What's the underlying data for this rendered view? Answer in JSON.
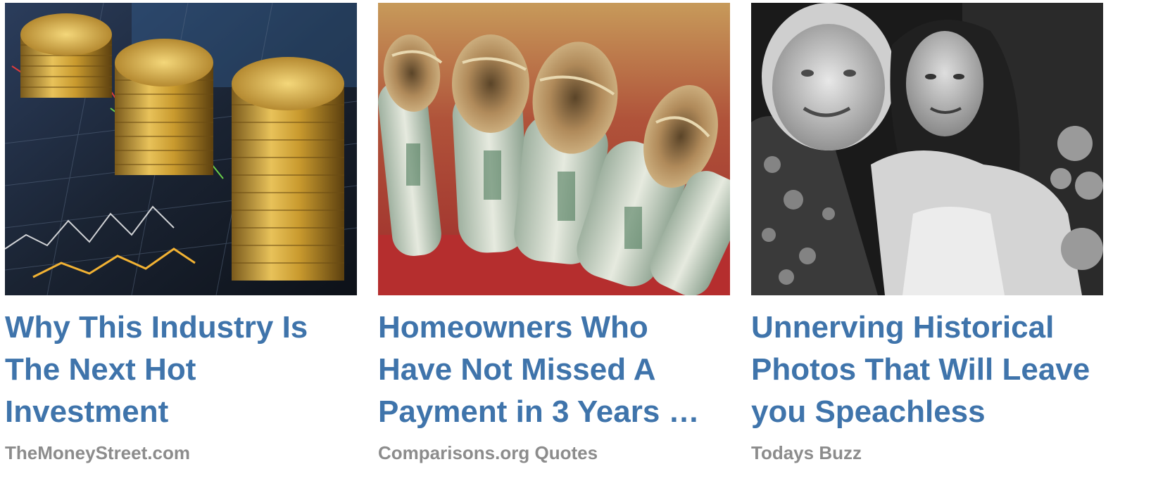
{
  "cards": [
    {
      "headline_lines": [
        "Why This Industry Is",
        "The Next Hot",
        "Investment"
      ],
      "source": "TheMoneyStreet.com",
      "image": "gold-coin-stacks-on-stock-chart"
    },
    {
      "headline_lines": [
        "Homeowners Who",
        "Have Not Missed A",
        "Payment in 3 Years …"
      ],
      "source": "Comparisons.org Quotes",
      "image": "rolled-dollar-bills"
    },
    {
      "headline_lines": [
        "Unnerving Historical",
        "Photos That Will Leave",
        "you Speachless"
      ],
      "source": "Todays Buzz",
      "image": "black-and-white-couple-photo"
    }
  ],
  "colors": {
    "headline": "#3f74ab",
    "source": "#8c8c8c",
    "background": "#ffffff"
  }
}
